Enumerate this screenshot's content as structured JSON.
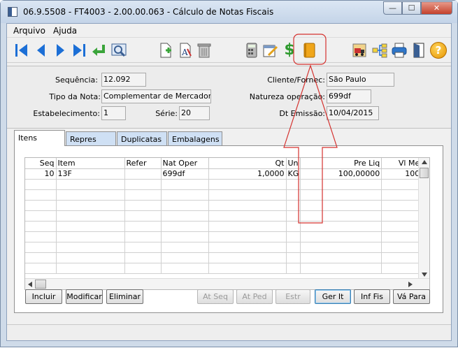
{
  "window": {
    "title": "06.9.5508 - FT4003 - 2.00.00.063 - Cálculo de Notas Fiscais",
    "min_glyph": "—",
    "max_glyph": "☐",
    "close_glyph": "✕"
  },
  "menu": {
    "items": [
      "Arquivo",
      "Ajuda"
    ]
  },
  "toolbar": {
    "icons": [
      "first-record-icon",
      "previous-record-icon",
      "next-record-icon",
      "last-record-icon",
      "return-icon",
      "zoom-search-icon",
      "new-document-icon",
      "text-format-icon",
      "trash-icon",
      "calculator-icon",
      "calendar-edit-icon",
      "dollar-icon",
      "notebook-icon",
      "truck-report-icon",
      "hierarchy-icon",
      "printer-icon",
      "exit-door-icon",
      "help-icon"
    ],
    "help_glyph": "?",
    "dollar_glyph": "$"
  },
  "form": {
    "sequencia_label": "Sequência:",
    "sequencia_value": "12.092",
    "tipo_nota_label": "Tipo da Nota:",
    "tipo_nota_value": "Complementar de Mercadoria",
    "estabelecimento_label": "Estabelecimento:",
    "estabelecimento_value": "1",
    "serie_label": "Série:",
    "serie_value": "20",
    "cliente_label": "Cliente/Fornec:",
    "cliente_value": "São Paulo",
    "natureza_label": "Natureza operação:",
    "natureza_value": "699df",
    "dt_emissao_label": "Dt Emissão:",
    "dt_emissao_value": "10/04/2015"
  },
  "tabs": [
    "Itens",
    "Repres",
    "Duplicatas",
    "Embalagens"
  ],
  "grid": {
    "columns": [
      "Seq",
      "Item",
      "Refer",
      "Nat Oper",
      "Qt",
      "Un",
      "Pre Liq",
      "Vl Me"
    ],
    "rows": [
      [
        "10",
        "13F",
        "",
        "699df",
        "1,0000",
        "KG",
        "100,00000",
        "100"
      ]
    ]
  },
  "buttons": {
    "incluir": "Incluir",
    "modificar": "Modificar",
    "eliminar": "Eliminar",
    "at_seq": "At Seq",
    "at_ped": "At Ped",
    "estr": "Estr",
    "ger_it": "Ger It",
    "inf_fis": "Inf Fis",
    "va_para": "Vá Para"
  },
  "colors": {
    "annotation": "#d4312e",
    "nav_blue": "#1c6fd6"
  }
}
